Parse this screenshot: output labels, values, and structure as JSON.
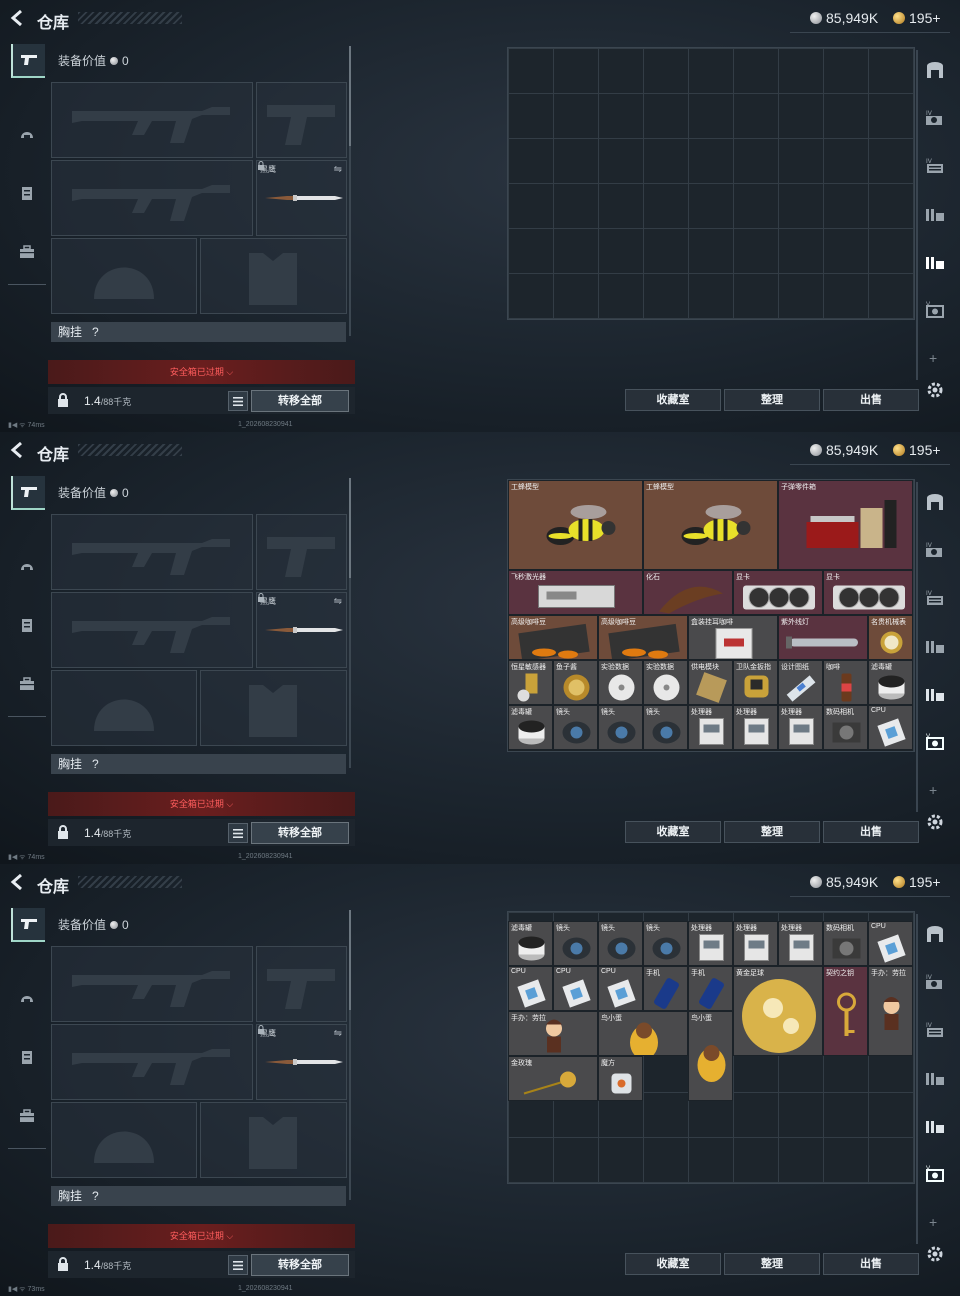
{
  "header": {
    "title": "仓库",
    "silver": "85,949K",
    "gold": "195+"
  },
  "equipment": {
    "value_label": "装备价值",
    "value": "0",
    "knife_label": "黑鹰",
    "chest_label": "胸挂",
    "chest_q": "?",
    "safe_box": "安全箱已过期",
    "capacity": "1.4",
    "capacity_max": "/88千克",
    "transfer_all": "转移全部"
  },
  "buttons": {
    "collection": "收藏室",
    "organize": "整理",
    "sell": "出售"
  },
  "status": {
    "ping": [
      "74ms",
      "74ms",
      "73ms"
    ],
    "build": "1_202608230941"
  },
  "icons": [
    "back-icon",
    "rifle-icon",
    "helmet-icon",
    "armor-icon",
    "briefcase-icon",
    "lock-icon",
    "list-icon",
    "gear-icon",
    "plus-icon",
    "safe-icon"
  ],
  "storage_view2": [
    {
      "name": "工蜂模型",
      "kind": "bee"
    },
    {
      "name": "工蜂模型",
      "kind": "bee"
    },
    {
      "name": "子弹零件箱",
      "kind": "ammo"
    },
    {
      "name": "飞秒激光器",
      "kind": "laser"
    },
    {
      "name": "化石",
      "kind": "fossil"
    },
    {
      "name": "显卡",
      "kind": "gpu"
    },
    {
      "name": "显卡",
      "kind": "gpu"
    },
    {
      "name": "高级咖啡豆",
      "kind": "coffee"
    },
    {
      "name": "高级咖啡豆",
      "kind": "coffee"
    },
    {
      "name": "盒装挂耳咖啡",
      "kind": "box"
    },
    {
      "name": "紫外线灯",
      "kind": "lamp"
    },
    {
      "name": "名贵机械表",
      "kind": "watch"
    },
    {
      "name": "恒星敏感器",
      "kind": "sensor"
    },
    {
      "name": "鱼子酱",
      "kind": "can"
    },
    {
      "name": "实验数据",
      "kind": "disc"
    },
    {
      "name": "实验数据",
      "kind": "disc"
    },
    {
      "name": "供电模块",
      "kind": "chip"
    },
    {
      "name": "卫队金扳指",
      "kind": "ring"
    },
    {
      "name": "设计图纸",
      "kind": "usb"
    },
    {
      "name": "咖啡",
      "kind": "bottle"
    },
    {
      "name": "滤毒罐",
      "kind": "filter"
    },
    {
      "name": "滤毒罐",
      "kind": "filter"
    },
    {
      "name": "镜头",
      "kind": "lens"
    },
    {
      "name": "镜头",
      "kind": "lens"
    },
    {
      "name": "镜头",
      "kind": "lens"
    },
    {
      "name": "处理器",
      "kind": "cpu2"
    },
    {
      "name": "处理器",
      "kind": "cpu2"
    },
    {
      "name": "处理器",
      "kind": "cpu2"
    },
    {
      "name": "数码相机",
      "kind": "camera"
    },
    {
      "name": "CPU",
      "kind": "cpu"
    },
    {
      "name": "CPU",
      "kind": "cpu"
    },
    {
      "name": "CPU",
      "kind": "cpu"
    },
    {
      "name": "CPU",
      "kind": "cpu"
    },
    {
      "name": "手机",
      "kind": "phone"
    },
    {
      "name": "手机",
      "kind": "phone"
    },
    {
      "name": "黄金足球",
      "kind": "ball"
    },
    {
      "name": "契约之钥",
      "kind": "key"
    },
    {
      "name": "手办：劳拉",
      "kind": "figure"
    },
    {
      "name": "手办：劳拉",
      "kind": "figure"
    },
    {
      "name": "鸟小蛋",
      "kind": "egg"
    },
    {
      "name": "鸟小蛋",
      "kind": "egg"
    }
  ],
  "storage_view3": [
    {
      "name": "滤毒罐",
      "kind": "filter"
    },
    {
      "name": "镜头",
      "kind": "lens"
    },
    {
      "name": "镜头",
      "kind": "lens"
    },
    {
      "name": "镜头",
      "kind": "lens"
    },
    {
      "name": "处理器",
      "kind": "cpu2"
    },
    {
      "name": "处理器",
      "kind": "cpu2"
    },
    {
      "name": "处理器",
      "kind": "cpu2"
    },
    {
      "name": "数码相机",
      "kind": "camera"
    },
    {
      "name": "CPU",
      "kind": "cpu"
    },
    {
      "name": "CPU",
      "kind": "cpu"
    },
    {
      "name": "CPU",
      "kind": "cpu"
    },
    {
      "name": "CPU",
      "kind": "cpu"
    },
    {
      "name": "手机",
      "kind": "phone"
    },
    {
      "name": "手机",
      "kind": "phone"
    },
    {
      "name": "黄金足球",
      "kind": "ball"
    },
    {
      "name": "契约之钥",
      "kind": "key"
    },
    {
      "name": "手办：劳拉",
      "kind": "figure"
    },
    {
      "name": "手办：劳拉",
      "kind": "figure"
    },
    {
      "name": "鸟小蛋",
      "kind": "egg"
    },
    {
      "name": "鸟小蛋",
      "kind": "egg"
    },
    {
      "name": "金玫瑰",
      "kind": "rose"
    },
    {
      "name": "魔方",
      "kind": "cube"
    }
  ]
}
